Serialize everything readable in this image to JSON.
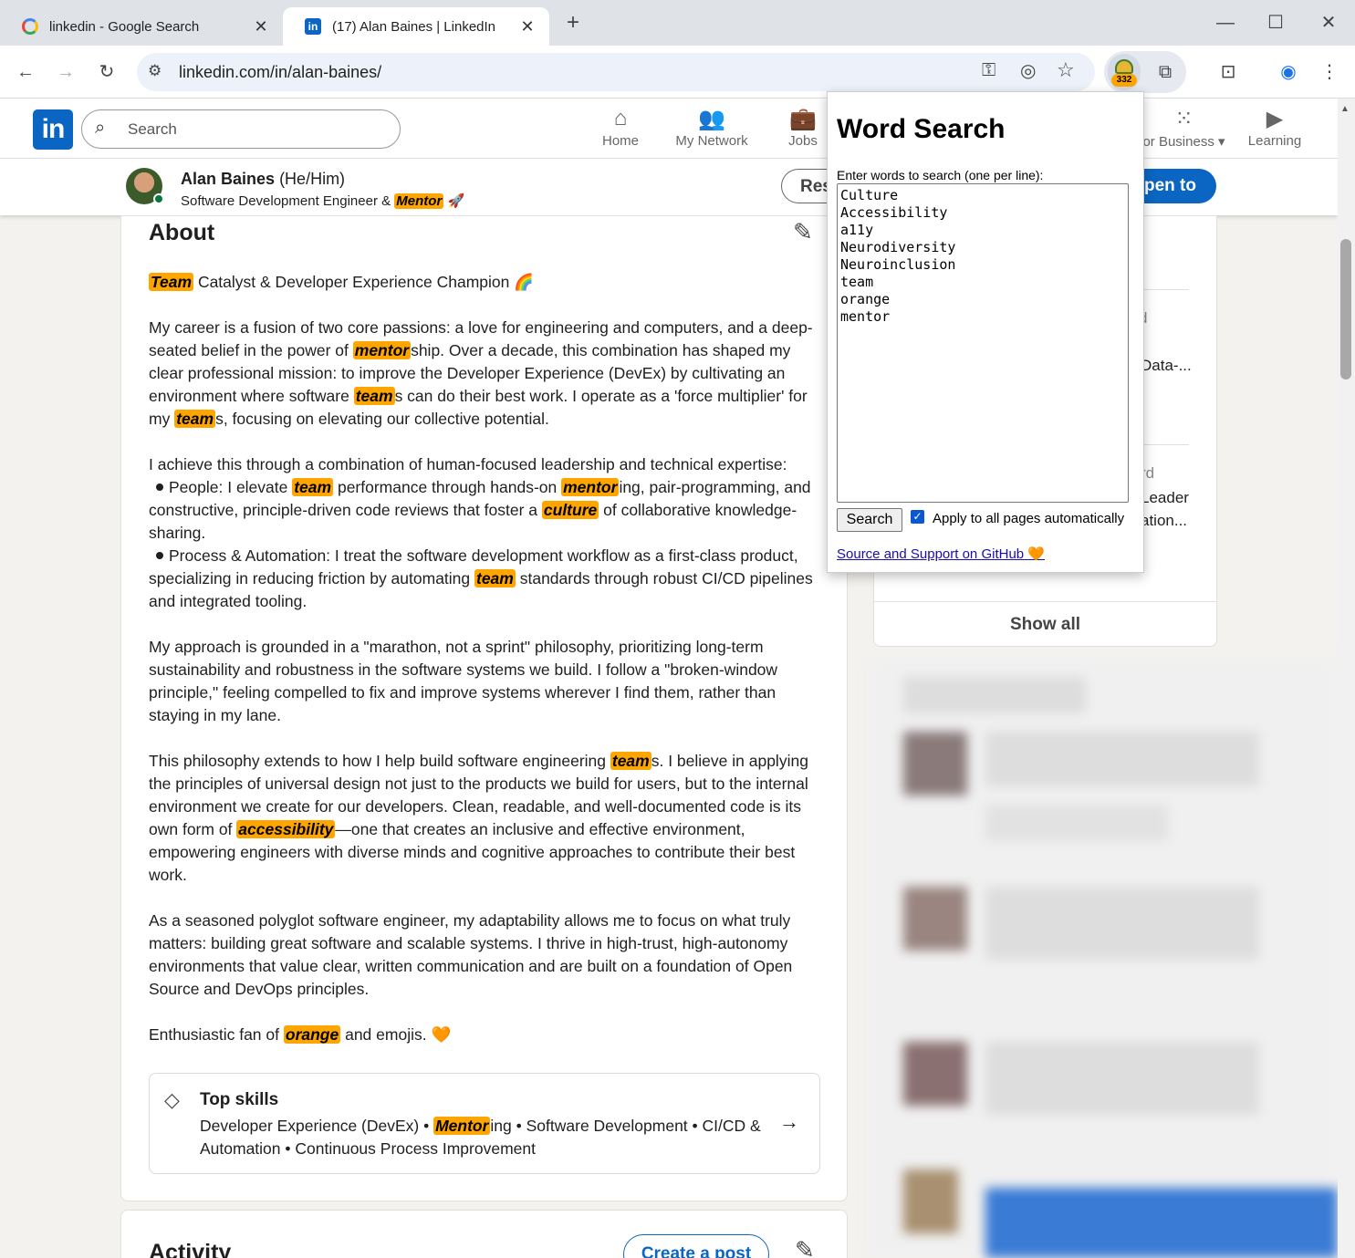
{
  "tabs": [
    {
      "title": "linkedin - Google Search"
    },
    {
      "title": "(17) Alan Baines | LinkedIn"
    }
  ],
  "toolbar": {
    "url": "linkedin.com/in/alan-baines/",
    "extension_badge": "332"
  },
  "linkedin": {
    "search_placeholder": "Search",
    "nav": [
      "Home",
      "My Network",
      "Jobs",
      "or Business",
      "Learning"
    ]
  },
  "profile": {
    "name": "Alan Baines",
    "pronouns": "(He/Him)",
    "headline_pre": "Software Development Engineer & ",
    "headline_hl": "Mentor",
    "headline_emoji": "🚀",
    "btn_resources": "Res",
    "btn_open": "pen to"
  },
  "about": {
    "title": "About",
    "p1": {
      "hl": "Team",
      "rest": " Catalyst & Developer Experience Champion 🌈"
    },
    "p2": {
      "a": "My career is a fusion of two core passions: a love for engineering and computers, and a deep-seated belief in the power of ",
      "h1": "mentor",
      "b": "ship. Over a decade, this combination has shaped my clear professional mission: to improve the Developer Experience (DevEx) by cultivating an environment where software ",
      "h2": "team",
      "c": "s can do their best work. I operate as a 'force multiplier' for my ",
      "h3": "team",
      "d": "s, focusing on elevating our collective potential."
    },
    "p3": {
      "intro": "I achieve this through a combination of human-focused leadership and technical expertise:",
      "b1a": "People: I elevate ",
      "b1h1": "team",
      "b1b": " performance through hands-on ",
      "b1h2": "mentor",
      "b1c": "ing, pair-programming, and constructive, principle-driven code reviews that foster a ",
      "b1h3": "culture",
      "b1d": " of collaborative knowledge-sharing.",
      "b2a": "Process & Automation: I treat the software development workflow as a first-class product, specializing in reducing friction by automating ",
      "b2h": "team",
      "b2b": " standards through robust CI/CD pipelines and integrated tooling."
    },
    "p4": "My approach is grounded in a \"marathon, not a sprint\" philosophy, prioritizing long-term sustainability and robustness in the software systems we build. I follow a \"broken-window principle,\" feeling compelled to fix and improve systems wherever I find them, rather than staying in my lane.",
    "p5": {
      "a": "This philosophy extends to how I help build software engineering ",
      "h1": "team",
      "b": "s. I believe in applying the principles of universal design not just to the products we build for users, but to the internal environment we create for our developers. Clean, readable, and well-documented code is its own form of ",
      "h2": "accessibility",
      "c": "—one that creates an inclusive and effective environment, empowering engineers with diverse minds and cognitive approaches to contribute their best work."
    },
    "p6": "As a seasoned polyglot software engineer, my adaptability allows me to focus on what truly matters: building great software and scalable systems. I thrive in high-trust, high-autonomy environments that value clear, written communication and are built on a foundation of Open Source and DevOps principles.",
    "p7": {
      "a": "Enthusiastic fan of ",
      "h": "orange",
      "b": " and emojis. 🧡"
    }
  },
  "skills": {
    "title": "Top skills",
    "a": "Developer Experience (DevEx) • ",
    "h": "Mentor",
    "b": "ing • Software Development • CI/CD & Automation • Continuous Process Improvement"
  },
  "activity": {
    "title": "Activity",
    "create_post": "Create a post"
  },
  "right": {
    "frag1": "d",
    "frag2": "Data-...",
    "frag3": "rd",
    "frag4": "Leader",
    "frag5": "ation...",
    "show_all": "Show all"
  },
  "popup": {
    "title": "Word Search",
    "label": "Enter words to search (one per line):",
    "words": "Culture\nAccessibility\na11y\nNeurodiversity\nNeuroinclusion\nteam\norange\nmentor",
    "search_btn": "Search",
    "apply_label": "Apply to all pages automatically",
    "link": "Source and Support on GitHub",
    "link_emoji": "🧡"
  },
  "colors": {
    "highlight": "#ffa500",
    "linkedin_blue": "#0a66c2"
  }
}
